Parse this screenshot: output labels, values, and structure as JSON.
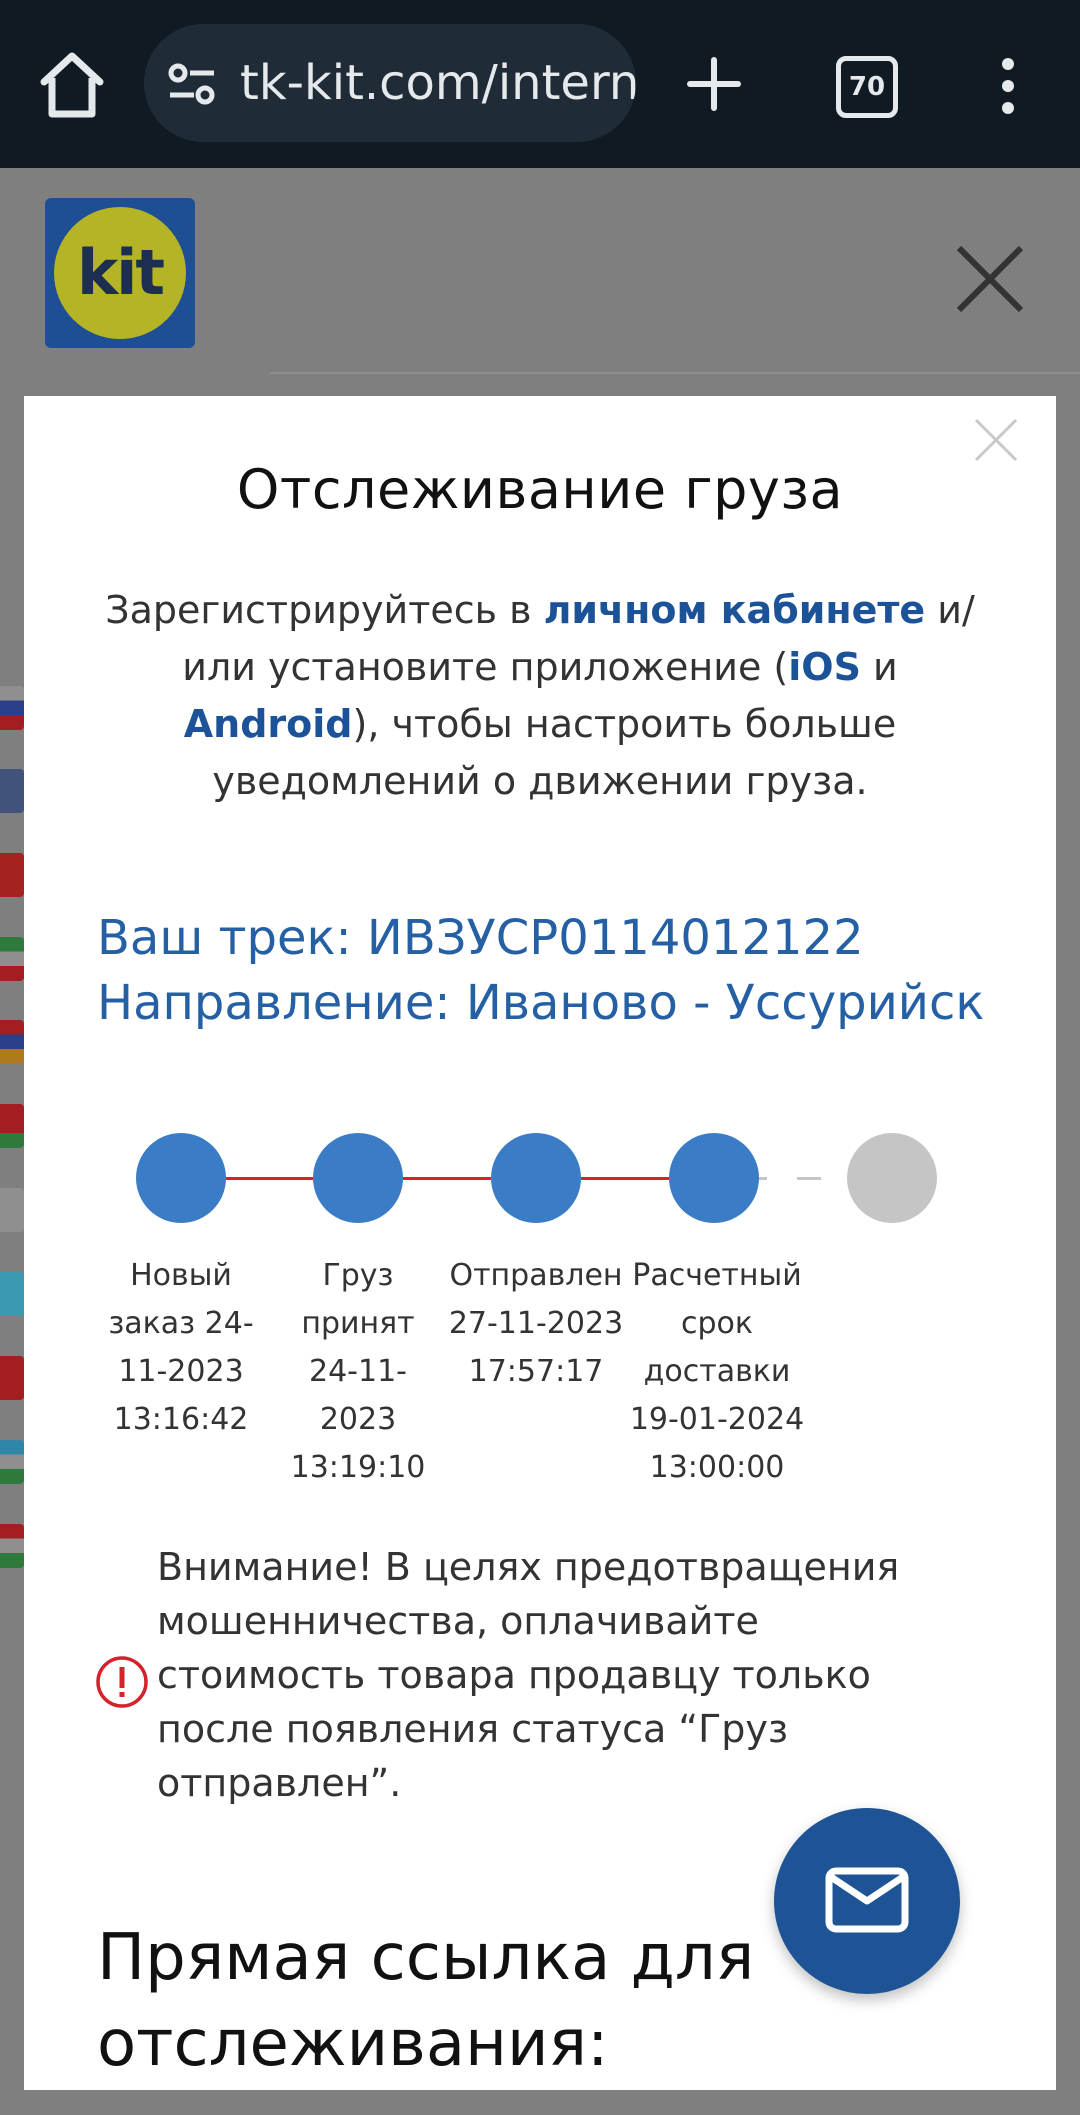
{
  "browser": {
    "url": "tk-kit.com/intern",
    "tab_count": "70"
  },
  "site": {
    "logo_text": "kit"
  },
  "modal": {
    "title": "Отслеживание груза",
    "intro": {
      "part1": "Зарегистрируйтесь в ",
      "link_cabinet": "личном кабинете",
      "part2": " и/или установите приложение (",
      "link_ios": "iOS",
      "part3": " и ",
      "link_android": "Android",
      "part4": "), чтобы настроить больше уведомлений о движении груза."
    },
    "track_line": "Ваш трек: ИВЗУСР0114012122",
    "direction_line": "Направление: Иваново - Уссурийск",
    "steps": [
      {
        "label": "Новый заказ 24-11-2023 13:16:42",
        "status": "done"
      },
      {
        "label": "Груз принят 24-11-2023 13:19:10",
        "status": "done"
      },
      {
        "label": "Отправлен 27-11-2023 17:57:17",
        "status": "done"
      },
      {
        "label": "Расчетный срок доставки 19-01-2024 13:00:00",
        "status": "done"
      },
      {
        "label": "",
        "status": "pending"
      }
    ],
    "warning": "Внимание! В целях предотвращения мошенничества, оплачивайте стоимость товара продавцу только после появления статуса “Груз отправлен”.",
    "direct_link_heading": "Прямая ссылка для отслеживания:"
  },
  "colors": {
    "done": "#3a7dc6",
    "pending": "#c5c5c5",
    "line_done": "#d5222b",
    "link": "#1c5298",
    "track": "#2560a4",
    "warning_icon": "#d5222b",
    "fab": "#1e5496"
  }
}
